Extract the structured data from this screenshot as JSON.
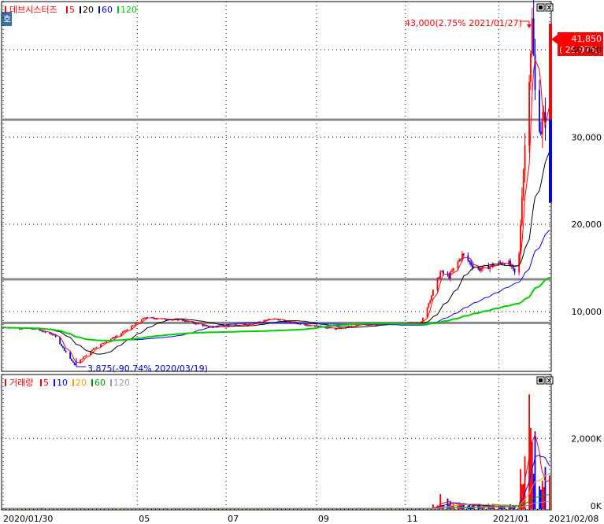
{
  "price_panel": {
    "title": "데브시스터즈",
    "ma_legend": [
      {
        "label": "5",
        "color": "#ff0000"
      },
      {
        "label": "20",
        "color": "#000000"
      },
      {
        "label": "60",
        "color": "#0000ff"
      },
      {
        "label": "120",
        "color": "#00cc00"
      }
    ],
    "high_label": "43,000(2.75% 2021/01/27)",
    "low_label": "3,875(-90.74% 2020/03/19)",
    "current_price": "41,850",
    "current_change": "( 29.97%)",
    "y_ticks": [
      "40,000",
      "30,000",
      "20,000",
      "10,000"
    ]
  },
  "volume_panel": {
    "title": "거래량",
    "ma_legend": [
      {
        "label": "5",
        "color": "#ff0000"
      },
      {
        "label": "10",
        "color": "#0000ff"
      },
      {
        "label": "20",
        "color": "#ff9900"
      },
      {
        "label": "60",
        "color": "#009900"
      },
      {
        "label": "120",
        "color": "#999999"
      }
    ],
    "y_ticks": [
      "2,000K",
      "0K"
    ]
  },
  "x_ticks": [
    "2020/01/30",
    "05",
    "07",
    "09",
    "11",
    "2021/01",
    "2021/02/08"
  ],
  "icons": {
    "corner_badge": "호"
  },
  "chart_data": [
    {
      "type": "line",
      "title": "데브시스터즈",
      "ylim": [
        3500,
        45000
      ],
      "price_anchor_dates": [
        "2020-01-30",
        "2020-02-20",
        "2020-03-05",
        "2020-03-19",
        "2020-04-01",
        "2020-04-20",
        "2020-05-06",
        "2020-06-01",
        "2020-06-20",
        "2020-07-15",
        "2020-08-01",
        "2020-08-20",
        "2020-09-15",
        "2020-10-01",
        "2020-10-30",
        "2020-11-12",
        "2020-11-25",
        "2020-12-01",
        "2020-12-10",
        "2020-12-20",
        "2020-12-29",
        "2021-01-10",
        "2021-01-15",
        "2021-01-18",
        "2021-01-20",
        "2021-01-22",
        "2021-01-25",
        "2021-01-27",
        "2021-01-29",
        "2021-02-02",
        "2021-02-05",
        "2021-02-08"
      ],
      "price_anchor_values": [
        8200,
        8000,
        7300,
        3875,
        5800,
        7500,
        9300,
        9000,
        8200,
        8500,
        9200,
        8600,
        8000,
        8500,
        8600,
        8800,
        14500,
        14000,
        16500,
        14800,
        15200,
        15800,
        14400,
        16500,
        24000,
        29000,
        38000,
        43000,
        35000,
        31000,
        32200,
        41850
      ],
      "series": [
        {
          "name": "5",
          "color": "#ff0000"
        },
        {
          "name": "20",
          "color": "#000000"
        },
        {
          "name": "60",
          "color": "#0000ff"
        },
        {
          "name": "120",
          "color": "#00cc00"
        }
      ],
      "horizontal_levels": [
        32000,
        13700,
        8700
      ]
    },
    {
      "type": "bar",
      "title": "거래량",
      "ylim": [
        0,
        3500
      ],
      "volume_peaks": [
        {
          "date": "2020-11-25",
          "value": 420
        },
        {
          "date": "2020-11-30",
          "value": 300
        },
        {
          "date": "2020-12-02",
          "value": 230
        },
        {
          "date": "2021-01-20",
          "value": 700
        },
        {
          "date": "2021-01-22",
          "value": 1500
        },
        {
          "date": "2021-01-25",
          "value": 3250
        },
        {
          "date": "2021-01-26",
          "value": 2300
        },
        {
          "date": "2021-01-27",
          "value": 1900
        },
        {
          "date": "2021-01-28",
          "value": 1000
        },
        {
          "date": "2021-01-29",
          "value": 2200
        },
        {
          "date": "2021-02-01",
          "value": 650
        },
        {
          "date": "2021-02-03",
          "value": 800
        }
      ]
    }
  ]
}
